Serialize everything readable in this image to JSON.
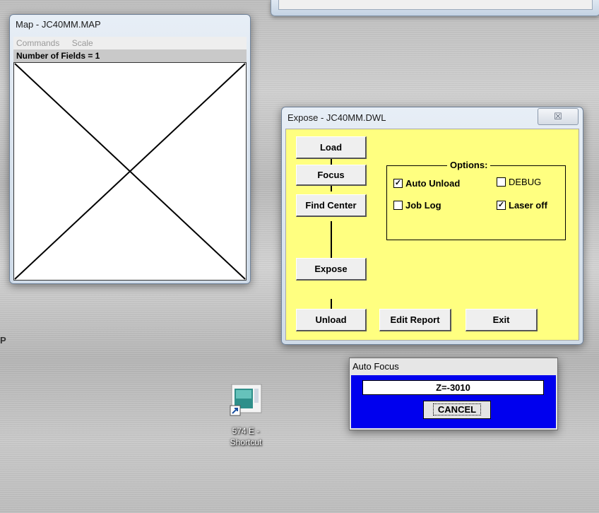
{
  "map_window": {
    "title": "Map - JC40MM.MAP",
    "menu": [
      "Commands",
      "Scale"
    ],
    "status": "Number of Fields = 1"
  },
  "expose_window": {
    "title": "Expose - JC40MM.DWL",
    "close_glyph": "☒",
    "buttons": {
      "load": "Load",
      "focus": "Focus",
      "find_center": "Find Center",
      "expose": "Expose",
      "unload": "Unload",
      "edit_report": "Edit Report",
      "exit": "Exit"
    },
    "options": {
      "title": "Options:",
      "auto_unload": {
        "label": "Auto Unload",
        "checked": true
      },
      "debug": {
        "label": "DEBUG",
        "checked": false
      },
      "job_log": {
        "label": "Job Log",
        "checked": false
      },
      "laser_off": {
        "label": "Laser off",
        "checked": true
      }
    },
    "bg_color": "#ffff80"
  },
  "auto_focus_window": {
    "title": "Auto Focus",
    "value": "Z=-3010",
    "cancel_label": "CANCEL",
    "bg_color": "#0000ee"
  },
  "desktop": {
    "shortcut_label_line1": "574 E -",
    "shortcut_label_line2": "Shortcut",
    "edge_mark": "P"
  }
}
